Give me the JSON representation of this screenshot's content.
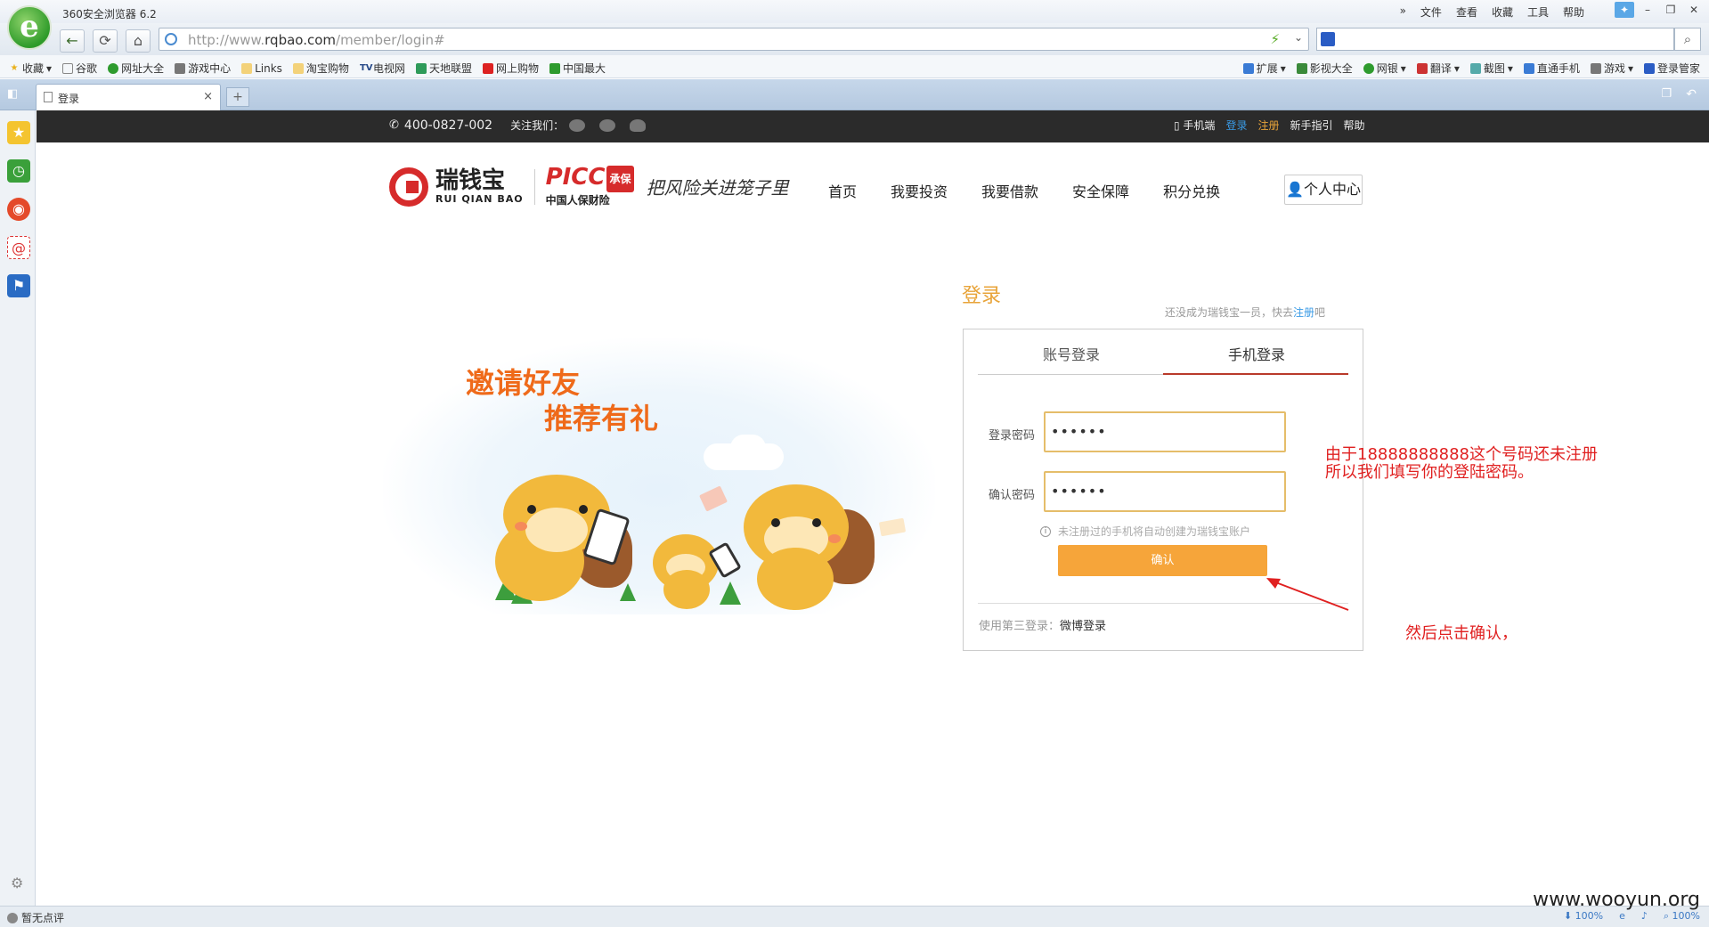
{
  "browser": {
    "title": "360安全浏览器 6.2",
    "logo_letter": "e",
    "menu": [
      "»",
      "文件",
      "查看",
      "收藏",
      "工具",
      "帮助"
    ],
    "window_buttons": [
      "skin",
      "minimize",
      "restore",
      "close"
    ],
    "url_prefix": "http://www.",
    "url_domain": "rqbao.com",
    "url_path": "/member/login#",
    "bookmarks_left": [
      {
        "label": "收藏",
        "icon": "star-icon",
        "dropdown": true
      },
      {
        "label": "谷歌",
        "icon": "page-icon"
      },
      {
        "label": "网址大全",
        "icon": "globe-icon"
      },
      {
        "label": "游戏中心",
        "icon": "gamepad-icon"
      },
      {
        "label": "Links",
        "icon": "folder-icon"
      },
      {
        "label": "淘宝购物",
        "icon": "folder-icon"
      },
      {
        "label": "电视网",
        "icon": "tv-icon"
      },
      {
        "label": "天地联盟",
        "icon": "app-icon"
      },
      {
        "label": "网上购物",
        "icon": "shop-icon"
      },
      {
        "label": "中国最大",
        "icon": "app-icon"
      }
    ],
    "bookmarks_right": [
      {
        "label": "扩展",
        "icon": "extension-icon"
      },
      {
        "label": "影视大全",
        "icon": "video-icon"
      },
      {
        "label": "网银",
        "icon": "shield-icon"
      },
      {
        "label": "翻译",
        "icon": "translate-icon"
      },
      {
        "label": "截图",
        "icon": "screenshot-icon"
      },
      {
        "label": "直通手机",
        "icon": "phone-icon"
      },
      {
        "label": "游戏",
        "icon": "gamepad-icon"
      },
      {
        "label": "登录管家",
        "icon": "key-icon"
      }
    ],
    "tab": {
      "label": "登录",
      "close": "×"
    },
    "new_tab": "+",
    "status_left": "暂无点评",
    "status_right": [
      "100%",
      "100%"
    ]
  },
  "site": {
    "topbar": {
      "phone": "400-0827-002",
      "follow_label": "关注我们：",
      "links": {
        "mobile": "手机端",
        "login": "登录",
        "register": "注册",
        "guide": "新手指引",
        "help": "帮助"
      }
    },
    "brand": {
      "name": "瑞钱宝",
      "name_en": "RUI QIAN BAO",
      "partner": "PICC",
      "partner_badge": "承保",
      "partner_sub": "中国人保财险",
      "slogan": "把风险关进笼子里"
    },
    "nav": [
      "首页",
      "我要投资",
      "我要借款",
      "安全保障",
      "积分兑换"
    ],
    "user_center": "个人中心",
    "banner": {
      "line1": "邀请好友",
      "line2": "推荐有礼"
    },
    "login": {
      "title": "登录",
      "register_hint_prefix": "还没成为瑞钱宝一员，快去",
      "register_link": "注册",
      "register_hint_suffix": "吧",
      "tabs": [
        {
          "label": "账号登录",
          "active": false
        },
        {
          "label": "手机登录",
          "active": true
        }
      ],
      "password_label": "登录密码",
      "password_value": "••••••",
      "confirm_label": "确认密码",
      "confirm_value": "••••••",
      "hint": "未注册过的手机将自动创建为瑞钱宝账户",
      "confirm_button": "确认",
      "third_party_label": "使用第三登录：",
      "third_party_link": "微博登录"
    }
  },
  "annotations": {
    "note1_line1": "由于18888888888这个号码还未注册",
    "note1_line2": "所以我们填写你的登陆密码。",
    "note2": "然后点击确认，",
    "color": "#e02020"
  },
  "watermark": "www.wooyun.org",
  "colors": {
    "accent": "#e8a43a",
    "button": "#f6a53a",
    "brand_red": "#d62b2b",
    "link_blue": "#3a9be6"
  }
}
